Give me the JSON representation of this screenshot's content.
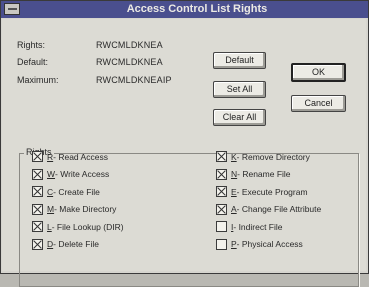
{
  "window": {
    "title": "Access Control List Rights"
  },
  "info": {
    "rights_label": "Rights:",
    "rights_value": "RWCMLDKNEA",
    "default_label": "Default:",
    "default_value": "RWCMLDKNEA",
    "maximum_label": "Maximum:",
    "maximum_value": "RWCMLDKNEAIP"
  },
  "buttons": {
    "default": "Default",
    "set_all": "Set All",
    "clear_all": "Clear All",
    "ok": "OK",
    "cancel": "Cancel"
  },
  "group": {
    "title": "Rights"
  },
  "rights": [
    {
      "key": "R",
      "label": " - Read Access",
      "checked": true
    },
    {
      "key": "W",
      "label": " - Write Access",
      "checked": true
    },
    {
      "key": "C",
      "label": " - Create File",
      "checked": true
    },
    {
      "key": "M",
      "label": " - Make Directory",
      "checked": true
    },
    {
      "key": "L",
      "label": " - File Lookup (DIR)",
      "checked": true
    },
    {
      "key": "D",
      "label": " - Delete File",
      "checked": true
    },
    {
      "key": "K",
      "label": " - Remove Directory",
      "checked": true
    },
    {
      "key": "N",
      "label": " - Rename File",
      "checked": true
    },
    {
      "key": "E",
      "label": " - Execute Program",
      "checked": true
    },
    {
      "key": "A",
      "label": " - Change File Attribute",
      "checked": true
    },
    {
      "key": "I",
      "label": " - Indirect File",
      "checked": false
    },
    {
      "key": "P",
      "label": " - Physical Access",
      "checked": false
    }
  ]
}
